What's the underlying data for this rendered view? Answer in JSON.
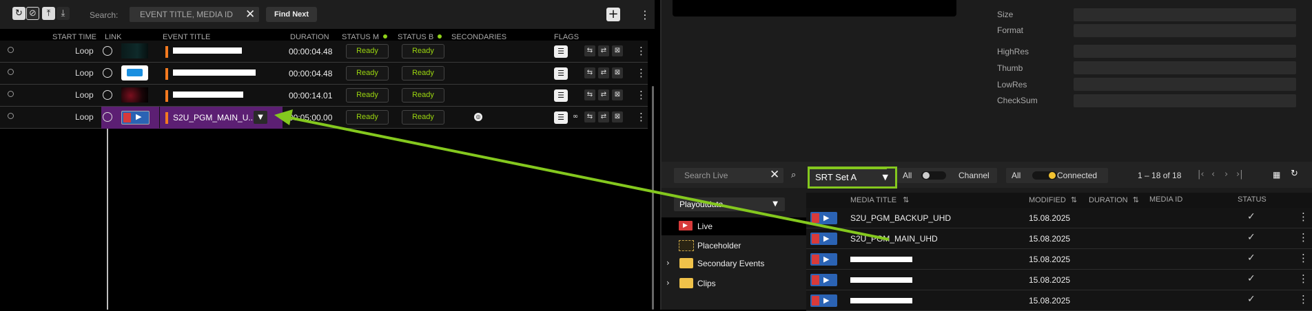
{
  "toolbar": {
    "search_label": "Search:",
    "search_placeholder": "EVENT TITLE, MEDIA ID",
    "find_next": "Find Next",
    "icons": [
      "refresh-icon",
      "no-timer-icon",
      "align-top-icon",
      "align-bottom-icon"
    ]
  },
  "columns": {
    "start_time": "START TIME",
    "link": "LINK",
    "event_title": "EVENT TITLE",
    "duration": "DURATION",
    "status_m": "STATUS M",
    "status_b": "STATUS B",
    "secondaries": "SECONDARIES",
    "flags": "FLAGS"
  },
  "events": [
    {
      "start": "Loop",
      "title": "",
      "duration": "00:00:04.48",
      "status_m": "Ready",
      "status_b": "Ready"
    },
    {
      "start": "Loop",
      "title": "",
      "duration": "00:00:04.48",
      "status_m": "Ready",
      "status_b": "Ready"
    },
    {
      "start": "Loop",
      "title": "",
      "duration": "00:00:14.01",
      "status_m": "Ready",
      "status_b": "Ready"
    },
    {
      "start": "Loop",
      "title": "S2U_PGM_MAIN_U...",
      "duration": "00:05:00.00",
      "status_m": "Ready",
      "status_b": "Ready",
      "selected": true
    }
  ],
  "properties": {
    "labels": [
      "Size",
      "Format",
      "HighRes",
      "Thumb",
      "LowRes",
      "CheckSum"
    ]
  },
  "library": {
    "search_placeholder": "Search Live",
    "set_select": "SRT Set A",
    "channel_all": "All",
    "channel_label": "Channel",
    "connected_all": "All",
    "connected_label": "Connected",
    "pager": "1 – 18 of 18",
    "tree_select": "Playoutdata",
    "tree": [
      {
        "label": "Live",
        "icon": "live-icon"
      },
      {
        "label": "Placeholder",
        "icon": "placeholder-icon"
      },
      {
        "label": "Secondary Events",
        "icon": "folder-icon"
      },
      {
        "label": "Clips",
        "icon": "folder-icon"
      }
    ],
    "headers": {
      "title": "MEDIA TITLE",
      "modified": "MODIFIED",
      "duration": "DURATION",
      "media_id": "MEDIA ID",
      "status": "STATUS"
    },
    "rows": [
      {
        "title": "S2U_PGM_BACKUP_UHD",
        "modified": "15.08.2025"
      },
      {
        "title": "S2U_PGM_MAIN_UHD",
        "modified": "15.08.2025"
      },
      {
        "title": "",
        "modified": "15.08.2025"
      },
      {
        "title": "",
        "modified": "15.08.2025"
      },
      {
        "title": "",
        "modified": "15.08.2025"
      }
    ]
  },
  "colors": {
    "accent_green": "#84c81e",
    "ready_green": "#9bd60f",
    "selected_purple": "#5c1f73",
    "event_orange": "#f47a20",
    "connected_yellow": "#f2c230"
  }
}
